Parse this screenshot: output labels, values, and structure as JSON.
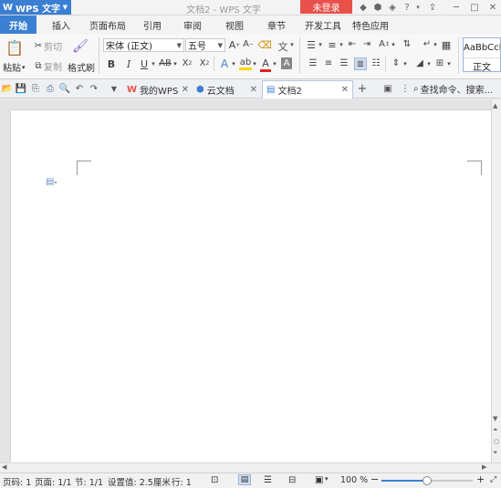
{
  "titlebar": {
    "app_name": "WPS 文字",
    "app_logo": "W",
    "window_title": "文档2 - WPS 文字",
    "login_label": "未登录",
    "icons": [
      "skin-icon",
      "settings-hex-icon",
      "theme-icon",
      "help-icon",
      "upload-icon",
      "minimize-icon",
      "maximize-icon",
      "close-icon"
    ]
  },
  "ribbon_tabs": [
    "开始",
    "插入",
    "页面布局",
    "引用",
    "审阅",
    "视图",
    "章节",
    "开发工具",
    "特色应用"
  ],
  "ribbon": {
    "paste_label": "粘贴",
    "cut_label": "剪切",
    "copy_label": "复制",
    "format_painter_label": "格式刷",
    "font_name": "宋体 (正文)",
    "font_size": "五号",
    "style_preview": "AaBbCcD",
    "style_name": "正文"
  },
  "doc_tabs": {
    "tabs": [
      {
        "label": "我的WPS",
        "icon": "wps-logo-icon"
      },
      {
        "label": "云文档",
        "icon": "cloud-doc-icon"
      },
      {
        "label": "文档2",
        "icon": "document-icon",
        "active": true
      }
    ],
    "add_label": "+",
    "search_placeholder": "查找命令、搜索..."
  },
  "statusbar": {
    "page": "页码: 1",
    "pages": "页面: 1/1",
    "section": "节: 1/1",
    "setting": "设置值: 2.5厘米",
    "row": "行: 1",
    "zoom": "100 %",
    "zoom_minus": "−",
    "zoom_plus": "+",
    "zoom_level": 0.5
  },
  "colors": {
    "accent": "#3b7fd3",
    "login": "#e8514a",
    "highlight": "#ffd700",
    "font_color": "#e02020"
  }
}
